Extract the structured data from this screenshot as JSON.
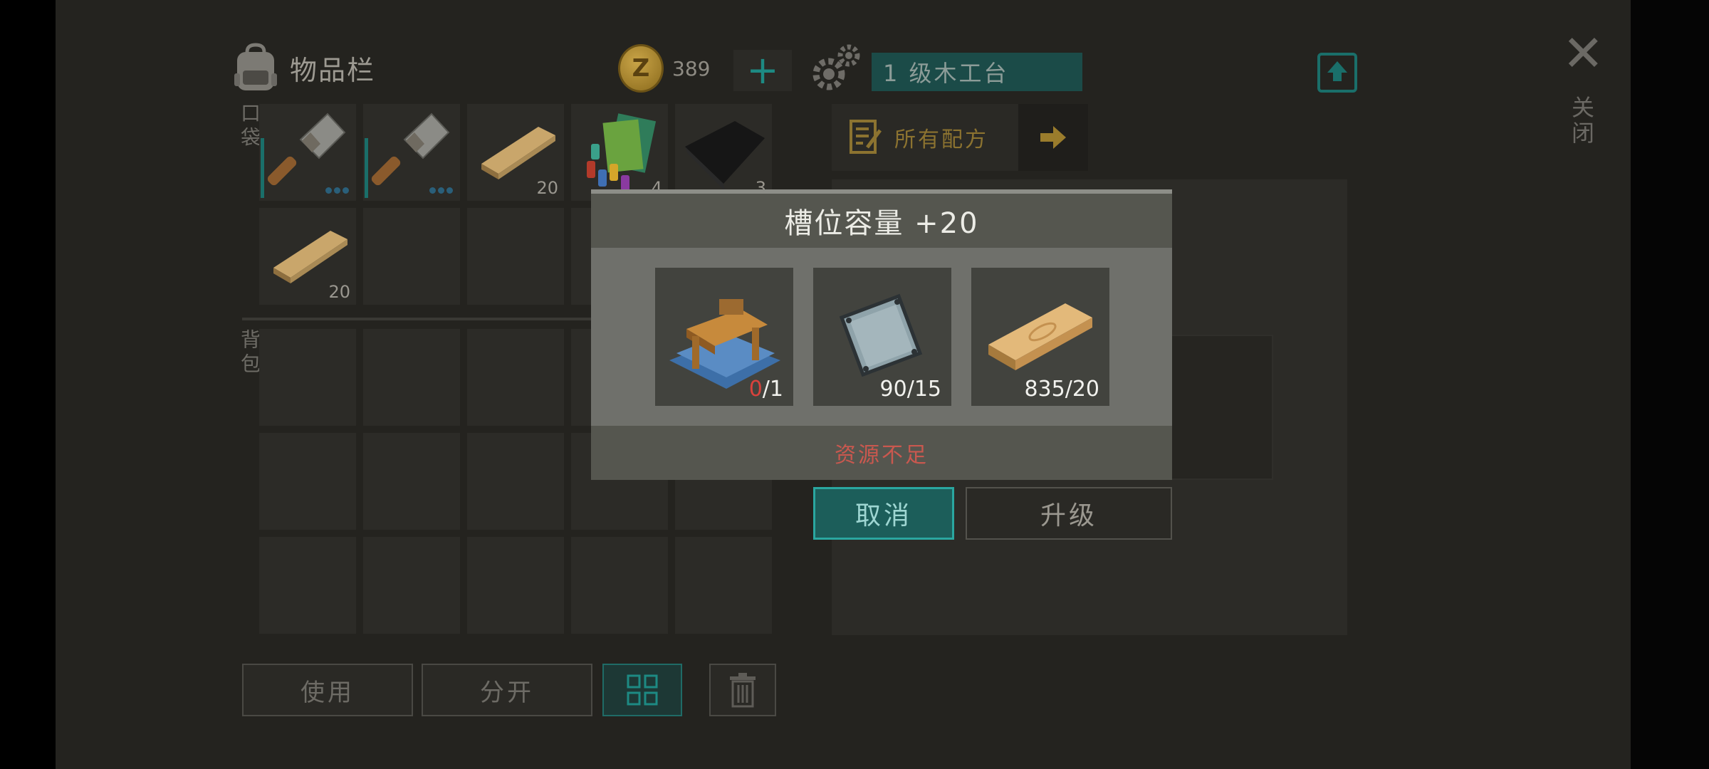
{
  "inventory": {
    "title": "物品栏",
    "coins": "389",
    "add_icon": "plus-icon",
    "pocket_label": "口袋",
    "backpack_label": "背包",
    "pocket_slots": [
      {
        "item": "cleaver",
        "count": ""
      },
      {
        "item": "cleaver",
        "count": ""
      },
      {
        "item": "wooden-plank",
        "count": "20"
      },
      {
        "item": "batteries-and-cards",
        "count": "4"
      },
      {
        "item": "black-fabric",
        "count": "3"
      },
      {
        "item": "wooden-plank",
        "count": "20"
      }
    ]
  },
  "bottom_bar": {
    "use_label": "使用",
    "split_label": "分开",
    "sort_icon": "grid-sort-icon",
    "delete_icon": "trash-icon"
  },
  "workbench": {
    "title": "1 级木工台",
    "recipes_label": "所有配方",
    "close_label": "关闭"
  },
  "dialog": {
    "title": "槽位容量 +20",
    "requirements": [
      {
        "item": "workbench-blueprint",
        "have": "0",
        "need": "/1"
      },
      {
        "item": "metal-plate",
        "have": "90",
        "need": "/15"
      },
      {
        "item": "wooden-plank",
        "have": "835",
        "need": "/20"
      }
    ],
    "status": "资源不足",
    "cancel_label": "取消",
    "upgrade_label": "升级"
  },
  "colors": {
    "accent_teal": "#1d8a83",
    "warning_red": "#d9423c",
    "gold": "#8c7330"
  }
}
